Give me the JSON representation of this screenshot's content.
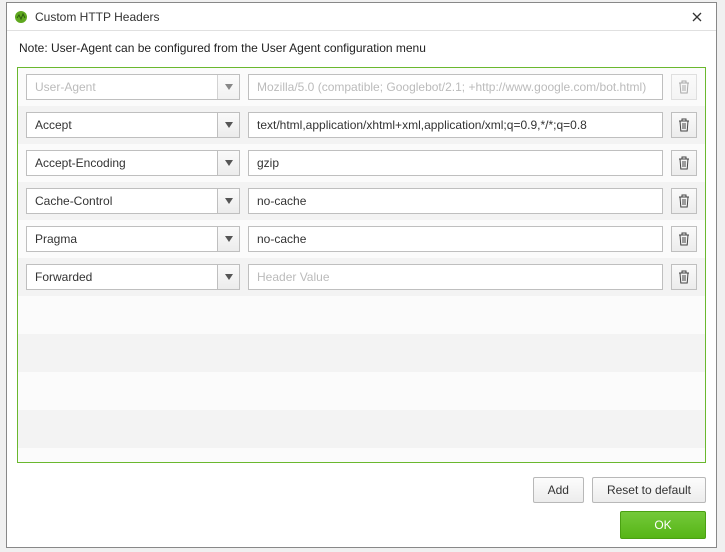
{
  "window": {
    "title": "Custom HTTP Headers"
  },
  "note": "Note: User-Agent can be configured from the User Agent configuration menu",
  "value_placeholder": "Header Value",
  "headers": [
    {
      "name": "User-Agent",
      "value": "Mozilla/5.0 (compatible; Googlebot/2.1; +http://www.google.com/bot.html)",
      "disabled": true
    },
    {
      "name": "Accept",
      "value": "text/html,application/xhtml+xml,application/xml;q=0.9,*/*;q=0.8",
      "disabled": false
    },
    {
      "name": "Accept-Encoding",
      "value": "gzip",
      "disabled": false
    },
    {
      "name": "Cache-Control",
      "value": "no-cache",
      "disabled": false
    },
    {
      "name": "Pragma",
      "value": "no-cache",
      "disabled": false
    },
    {
      "name": "Forwarded",
      "value": "",
      "disabled": false
    }
  ],
  "buttons": {
    "add": "Add",
    "reset": "Reset to default",
    "ok": "OK"
  }
}
